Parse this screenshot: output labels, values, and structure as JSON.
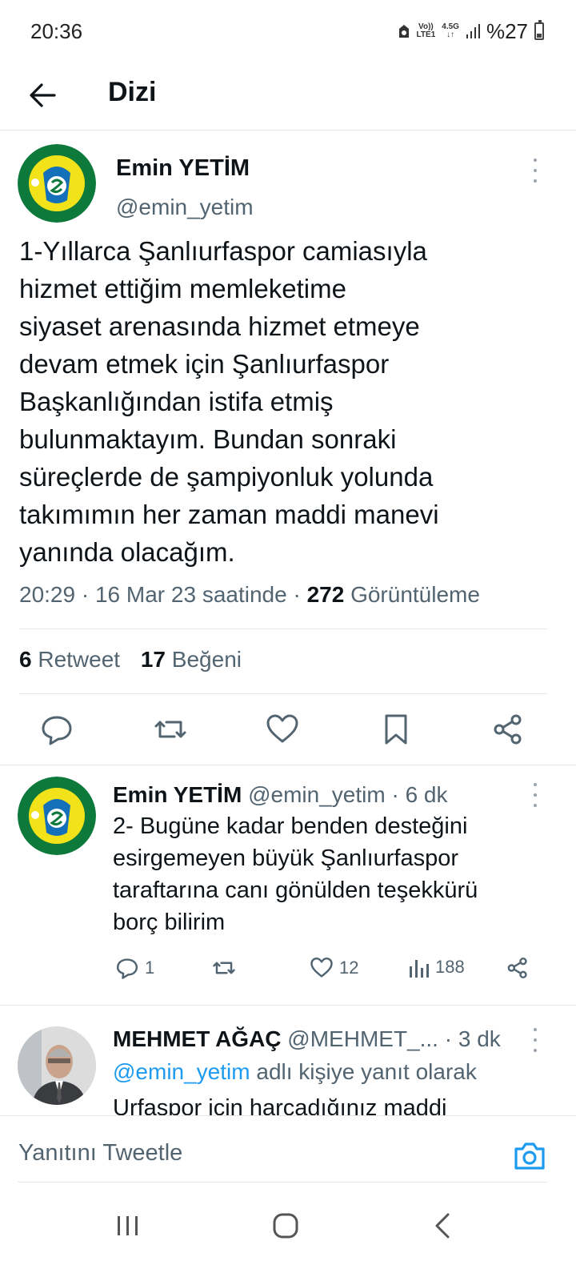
{
  "status_bar": {
    "time": "20:36",
    "network_top": "Vo))",
    "network_bottom": "LTE1",
    "net_gen": "4.5G",
    "battery": "%27"
  },
  "header": {
    "title": "Dizi",
    "back_icon": "arrow-left-icon"
  },
  "main_tweet": {
    "name": "Emin YETİM",
    "handle": "@emin_yetim",
    "text": "1-Yıllarca Şanlıurfaspor camiasıyla\nhizmet ettiğim memleketime\nsiyaset arenasında hizmet etmeye\ndevam etmek için Şanlıurfaspor\nBaşkanlığından istifa etmiş\nbulunmaktayım. Bundan sonraki\nsüreçlerde de şampiyonluk yolunda\ntakımımın her zaman maddi manevi\nyanında olacağım.",
    "time": "20:29",
    "date_text": "16 Mar 23 saatinde",
    "views": "272",
    "views_label": "Görüntüleme",
    "retweets": "6",
    "retweets_label": "Retweet",
    "likes": "17",
    "likes_label": "Beğeni",
    "logo_text_top": "ŞANLIURFA",
    "logo_text_bottom": "SPOR KULÜBÜ"
  },
  "reply1": {
    "name": "Emin YETİM",
    "handle": "@emin_yetim",
    "time": "6 dk",
    "text": "2- Bugüne kadar benden desteğini\nesirgemeyen büyük Şanlıurfaspor\ntaraftarına canı gönülden teşekkürü\nborç bilirim",
    "replies": "1",
    "likes": "12",
    "views": "188"
  },
  "reply2": {
    "name": "MEHMET AĞAÇ",
    "handle": "@MEHMET_...",
    "time": "3 dk",
    "reply_to_handle": "@emin_yetim",
    "reply_to_suffix": "adlı kişiye yanıt olarak",
    "text_partial": "Urfaspor için harcadığınız maddi"
  },
  "compose": {
    "placeholder": "Yanıtını Tweetle",
    "camera_icon": "camera-icon"
  },
  "colors": {
    "link": "#1d9bf0",
    "muted": "#536471",
    "text": "#0f1419"
  }
}
